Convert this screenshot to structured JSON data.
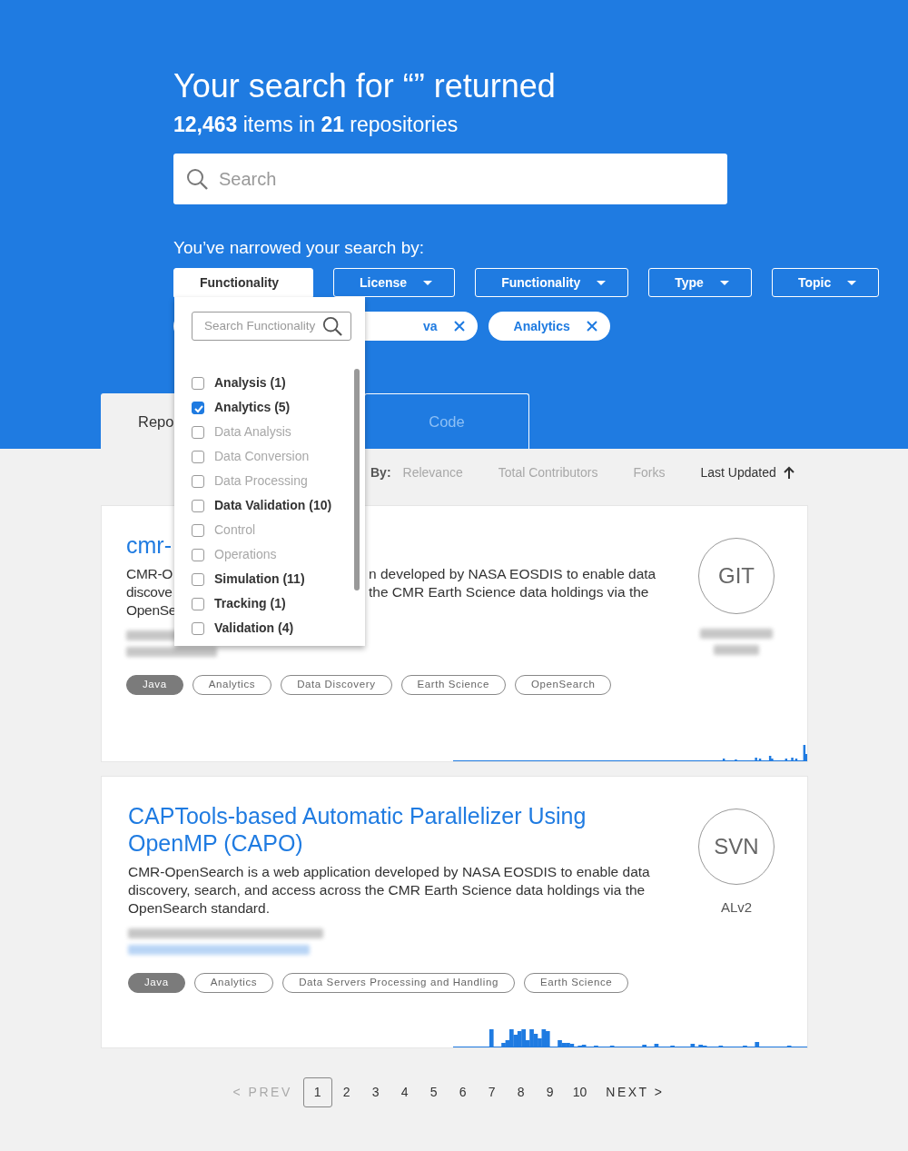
{
  "header": {
    "title": "Your search for “” returned",
    "summary": "**12,463** items in **21** repositories",
    "search": {
      "placeholder": "Search"
    },
    "narrowed_label": "You’ve narrowed your search by:"
  },
  "filters": [
    {
      "label": "Functionality",
      "open": true
    },
    {
      "label": "License",
      "open": false
    },
    {
      "label": "Functionality",
      "open": false
    },
    {
      "label": "Type",
      "open": false
    },
    {
      "label": "Topic",
      "open": false
    }
  ],
  "chips": [
    {
      "kind": "covered"
    },
    {
      "kind": "chip",
      "label": "va"
    },
    {
      "kind": "chip",
      "label": "Analytics"
    }
  ],
  "dropdown": {
    "search": {
      "placeholder": "Search Functionality"
    },
    "items": [
      {
        "label": "Analysis (1)",
        "checked": false,
        "disabled": false
      },
      {
        "label": "Analytics (5)",
        "checked": true,
        "disabled": false
      },
      {
        "label": "Data Analysis",
        "checked": false,
        "disabled": true
      },
      {
        "label": "Data Conversion",
        "checked": false,
        "disabled": true
      },
      {
        "label": "Data Processing",
        "checked": false,
        "disabled": true
      },
      {
        "label": "Data Validation (10)",
        "checked": false,
        "disabled": false
      },
      {
        "label": "Control",
        "checked": false,
        "disabled": true
      },
      {
        "label": "Operations",
        "checked": false,
        "disabled": true
      },
      {
        "label": "Simulation (11)",
        "checked": false,
        "disabled": false
      },
      {
        "label": "Tracking (1)",
        "checked": false,
        "disabled": false
      },
      {
        "label": "Validation (4)",
        "checked": false,
        "disabled": false
      }
    ]
  },
  "tabs": [
    {
      "label": "Repo",
      "selected": true
    },
    {
      "label": "Code",
      "selected": false
    }
  ],
  "sort": {
    "label": "By:",
    "options": [
      {
        "label": "Relevance",
        "selected": false
      },
      {
        "label": "Total Contributors",
        "selected": false
      },
      {
        "label": "Forks",
        "selected": false
      },
      {
        "label": "Last Updated",
        "selected": true
      }
    ]
  },
  "results": [
    {
      "title": "cmr-",
      "description_lines": [
        {
          "left": "CMR-O",
          "right": "n developed by NASA EOSDIS to enable data"
        },
        {
          "left": "discove",
          "right": "the CMR Earth Science data holdings via the"
        },
        {
          "left": "OpenSe"
        }
      ],
      "repo_type": "GIT",
      "tags": [
        {
          "label": "Java",
          "kind": "language"
        },
        {
          "label": "Analytics",
          "kind": "topic"
        },
        {
          "label": "Data Discovery",
          "kind": "topic"
        },
        {
          "label": "Earth Science",
          "kind": "topic"
        },
        {
          "label": "OpenSearch",
          "kind": "topic"
        }
      ]
    },
    {
      "title": "CAPTools-based Automatic Parallelizer Using OpenMP (CAPO)",
      "description": "CMR-OpenSearch is a web application developed by NASA EOSDIS to enable data discovery, search, and access across the CMR Earth Science data holdings via the OpenSearch standard.",
      "repo_type": "SVN",
      "license": "ALv2",
      "tags": [
        {
          "label": "Java",
          "kind": "language"
        },
        {
          "label": "Analytics",
          "kind": "topic"
        },
        {
          "label": "Data Servers Processing and Handling",
          "kind": "topic"
        },
        {
          "label": "Earth Science",
          "kind": "topic"
        }
      ]
    }
  ],
  "pagination": {
    "prev": "< PREV",
    "next": "NEXT >",
    "pages": [
      {
        "label": "1",
        "selected": true
      },
      {
        "label": "2",
        "selected": false
      },
      {
        "label": "3",
        "selected": false
      },
      {
        "label": "4",
        "selected": false
      },
      {
        "label": "5",
        "selected": false
      },
      {
        "label": "6",
        "selected": false
      },
      {
        "label": "7",
        "selected": false
      },
      {
        "label": "8",
        "selected": false
      },
      {
        "label": "9",
        "selected": false
      },
      {
        "label": "10",
        "selected": false
      }
    ]
  }
}
